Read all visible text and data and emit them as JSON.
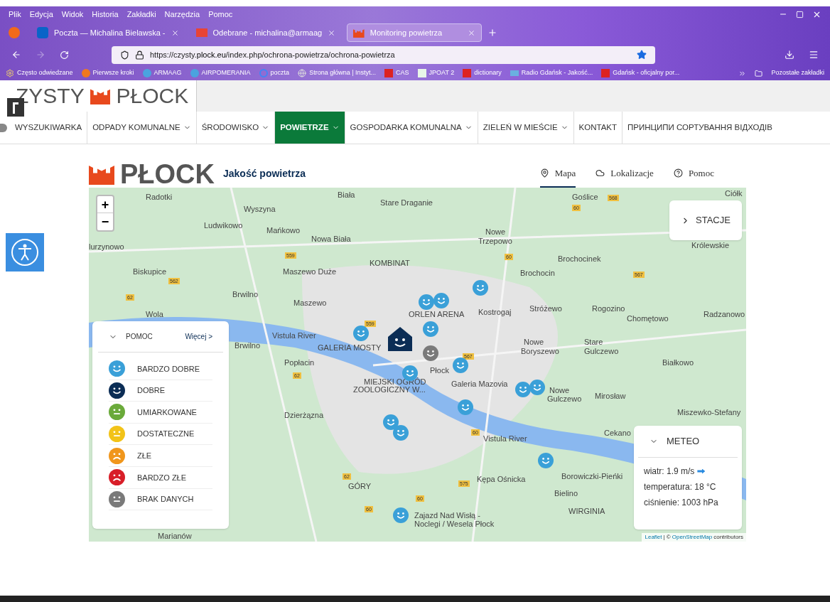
{
  "menu_bar": [
    "Plik",
    "Edycja",
    "Widok",
    "Historia",
    "Zakładki",
    "Narzędzia",
    "Pomoc"
  ],
  "tabs": [
    {
      "label": "Poczta — Michalina Bielawska -",
      "selected": false,
      "kind": "outlook"
    },
    {
      "label": "Odebrane - michalina@armaag",
      "selected": false,
      "kind": "gmail"
    },
    {
      "label": "Monitoring powietrza",
      "selected": true,
      "kind": "plock"
    }
  ],
  "address_bar": {
    "url_prefix": "https://czysty.",
    "url_domain": "plock.eu",
    "url_path": "/index.php/ochrona-powietrza/ochrona-powietrza",
    "bookmarked": true
  },
  "bookmarks": [
    {
      "label": "Często odwiedzane",
      "kind": "gear"
    },
    {
      "label": "Pierwsze kroki",
      "kind": "firefox"
    },
    {
      "label": "ARMAAG",
      "kind": "smile"
    },
    {
      "label": "AIRPOMERANIA",
      "kind": "smile"
    },
    {
      "label": "poczta",
      "kind": "google"
    },
    {
      "label": "Strona główna | Instyt...",
      "kind": "globe"
    },
    {
      "label": "CAS",
      "kind": "red"
    },
    {
      "label": "JPOAT 2",
      "kind": "doc"
    },
    {
      "label": "dictionary",
      "kind": "red"
    },
    {
      "label": "Radio Gdańsk - Jakość...",
      "kind": "rg"
    },
    {
      "label": "Gdańsk - oficjalny por...",
      "kind": "red"
    }
  ],
  "bookmarks_overflow": "Pozostałe zakładki",
  "site": {
    "logo_left": "ZYSTY",
    "logo_right": "PŁOCK"
  },
  "nav": [
    {
      "label": "WYSZUKIWARKA",
      "dropdown": false,
      "selected": false
    },
    {
      "label": "ODPADY KOMUNALNE",
      "dropdown": true,
      "selected": false
    },
    {
      "label": "ŚRODOWISKO",
      "dropdown": true,
      "selected": false
    },
    {
      "label": "POWIETRZE",
      "dropdown": true,
      "selected": true
    },
    {
      "label": "GOSPODARKA KOMUNALNA",
      "dropdown": true,
      "selected": false
    },
    {
      "label": "ZIELEŃ W MIEŚCIE",
      "dropdown": true,
      "selected": false
    },
    {
      "label": "KONTAKT",
      "dropdown": false,
      "selected": false
    },
    {
      "label": "ПРИНЦИПИ СОРТУВАННЯ ВІДХОДІВ",
      "dropdown": false,
      "selected": false
    }
  ],
  "app_header": {
    "logo": "PŁOCK",
    "title": "Jakość powietrza",
    "tabs": [
      {
        "label": "Mapa",
        "selected": true,
        "kind": "pin"
      },
      {
        "label": "Lokalizacje",
        "selected": false,
        "kind": "cloud"
      },
      {
        "label": "Pomoc",
        "selected": false,
        "kind": "help"
      }
    ]
  },
  "map": {
    "zoom_in": "+",
    "zoom_out": "−",
    "stations_button": "STACJE",
    "labels": [
      "Radotki",
      "Biała",
      "Stare Draganie",
      "Goślice",
      "Ciółk",
      "Wyszyna",
      "Ludwikowo",
      "Mańkowo",
      "Nowa Biała",
      "Nowe",
      "Trzepowo",
      "lurzynowo",
      "Królewskie",
      "Brochocinek",
      "KOMBINAT",
      "Biskupice",
      "Maszewo Duże",
      "Brochocin",
      "Brwilno",
      "Maszewo",
      "Rogozino",
      "Radzanowo",
      "Stróżewo",
      "Kostrogaj",
      "Chomętowo",
      "Wola",
      "ORLEN ARENA",
      "GALERIA MOSTY",
      "Nowe",
      "Boryszewo",
      "Stare",
      "Gulczewo",
      "Brwilno",
      "Popłacin",
      "Płock",
      "Białkowo",
      "MIEJSKI OGRÓD",
      "ZOOLOGICZNY W...",
      "Galeria Mazovia",
      "Nowe",
      "Gulczewo",
      "Mirosław",
      "Dzierżązna",
      "Miszewko-Stefany",
      "Cekano",
      "Kępa Ośnicka",
      "Borowiczki-Pieńki",
      "Bielino",
      "WIRGINIA",
      "GÓRY",
      "Zajazd Nad Wisłą -",
      "Noclegi / Wesela Płock",
      "Marianów",
      "Vistula River",
      "Vistula River"
    ],
    "road_badges": [
      "568",
      "60",
      "559",
      "562",
      "62",
      "60",
      "567",
      "559",
      "567",
      "62",
      "60",
      "575",
      "60",
      "62",
      "60"
    ],
    "markers": [
      {
        "color": "#3aa0d8",
        "selected": false
      },
      {
        "color": "#3aa0d8",
        "selected": false
      },
      {
        "color": "#3aa0d8",
        "selected": false
      },
      {
        "color": "#3aa0d8",
        "selected": false
      },
      {
        "color": "#3aa0d8",
        "selected": false
      },
      {
        "color": "#0b2d55",
        "selected": true
      },
      {
        "color": "#7a7a7a",
        "selected": false
      },
      {
        "color": "#3aa0d8",
        "selected": false
      },
      {
        "color": "#3aa0d8",
        "selected": false
      },
      {
        "color": "#3aa0d8",
        "selected": false
      },
      {
        "color": "#3aa0d8",
        "selected": false
      },
      {
        "color": "#3aa0d8",
        "selected": false
      },
      {
        "color": "#3aa0d8",
        "selected": false
      },
      {
        "color": "#3aa0d8",
        "selected": false
      },
      {
        "color": "#3aa0d8",
        "selected": false
      },
      {
        "color": "#3aa0d8",
        "selected": false
      }
    ],
    "attribution": {
      "leaflet": "Leaflet",
      "separator": "| ©",
      "osm": "OpenStreetMap",
      "suffix": "contributors"
    }
  },
  "legend": {
    "title": "POMOC",
    "expanded": true,
    "more": "Więcej >",
    "items": [
      {
        "label": "BARDZO DOBRE",
        "color": "#3aa0d8",
        "kind": "happy"
      },
      {
        "label": "DOBRE",
        "color": "#0b2d55",
        "kind": "happy"
      },
      {
        "label": "UMIARKOWANE",
        "color": "#6aaa3a",
        "kind": "neutral"
      },
      {
        "label": "DOSTATECZNE",
        "color": "#f2c318",
        "kind": "neutral"
      },
      {
        "label": "ZŁE",
        "color": "#f0961c",
        "kind": "sad"
      },
      {
        "label": "BARDZO ZŁE",
        "color": "#d81e28",
        "kind": "sad"
      },
      {
        "label": "BRAK DANYCH",
        "color": "#7a7a7a",
        "kind": "neutral"
      }
    ]
  },
  "meteo": {
    "title": "METEO",
    "expanded": true,
    "wind": "wiatr: 1.9 m/s",
    "temperature": "temperatura: 18 °C",
    "pressure": "ciśnienie: 1003 hPa"
  }
}
